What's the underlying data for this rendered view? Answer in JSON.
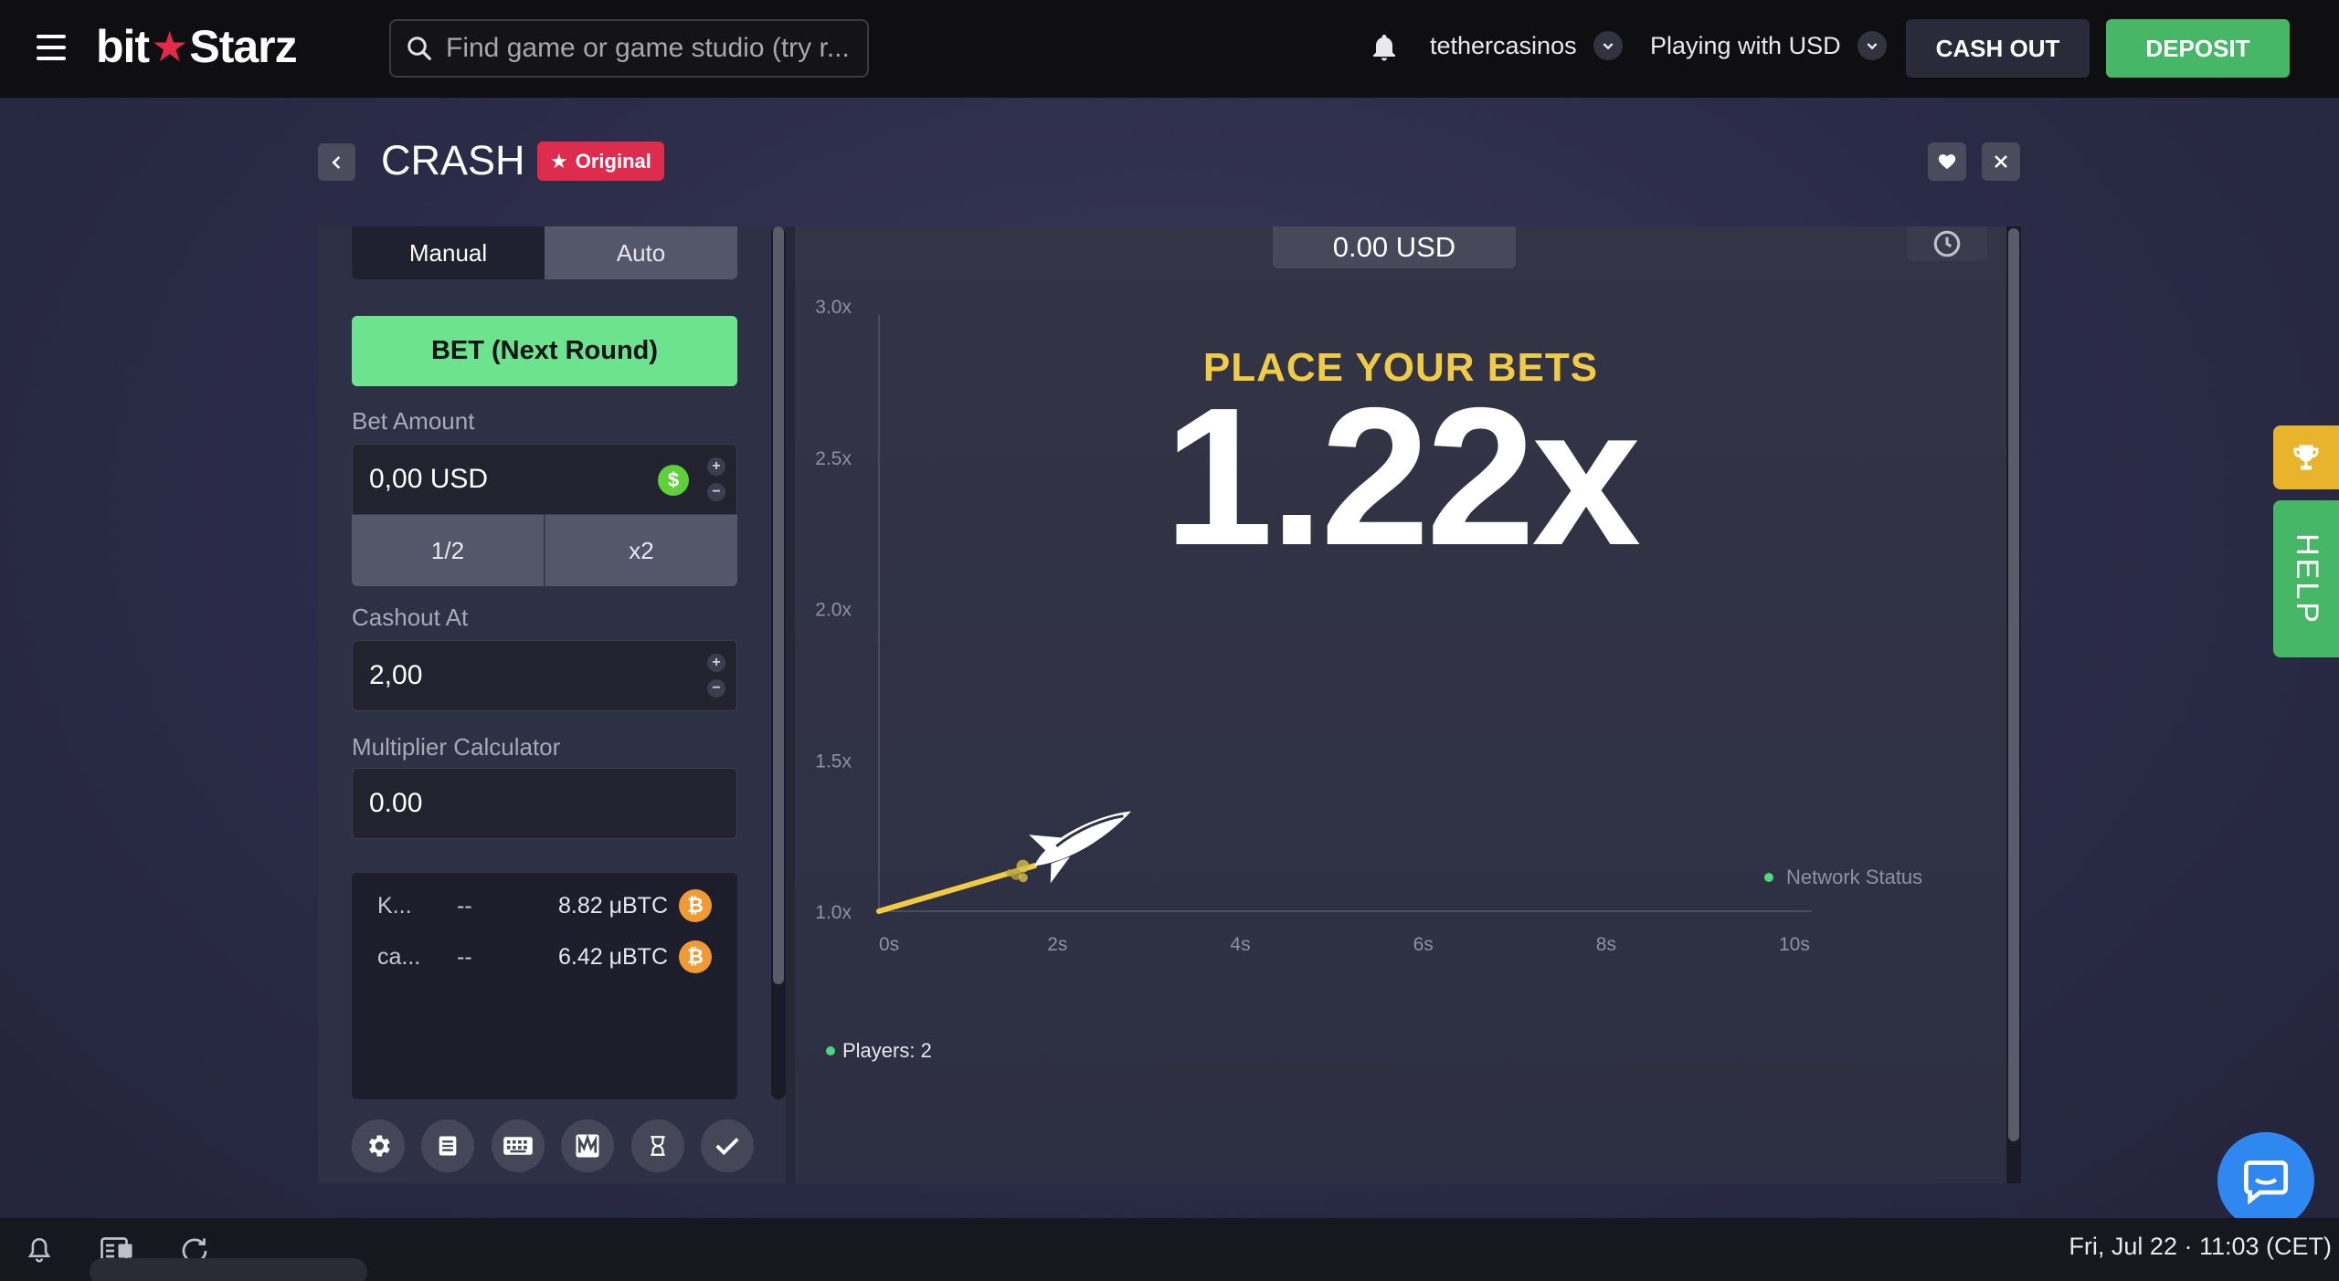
{
  "topbar": {
    "logo_left": "bit",
    "logo_right": "Starz",
    "search_placeholder": "Find game or game studio (try r...",
    "username": "tethercasinos",
    "currency_label": "Playing with USD",
    "cashout_label": "CASH OUT",
    "deposit_label": "DEPOSIT"
  },
  "game_header": {
    "title": "CRASH",
    "badge": "Original"
  },
  "left_panel": {
    "tabs": [
      "Manual",
      "Auto"
    ],
    "bet_button": "BET (Next Round)",
    "bet_amount_label": "Bet Amount",
    "bet_amount_value": "0,00 USD",
    "half_label": "1/2",
    "double_label": "x2",
    "cashout_label": "Cashout At",
    "cashout_value": "2,00",
    "calc_label": "Multiplier Calculator",
    "calc_value": "0.00",
    "players": [
      {
        "name": "K...",
        "mult": "--",
        "amount": "8.82 μBTC"
      },
      {
        "name": "ca...",
        "mult": "--",
        "amount": "6.42 μBTC"
      }
    ]
  },
  "game_area": {
    "balance": "0.00 USD",
    "status": "PLACE YOUR BETS",
    "multiplier": "1.22x",
    "network_status": "Network Status",
    "players_count": "Players: 2"
  },
  "chart_data": {
    "type": "line",
    "x_ticks": [
      "0s",
      "2s",
      "4s",
      "6s",
      "8s",
      "10s"
    ],
    "y_ticks": [
      "1.0x",
      "1.5x",
      "2.0x",
      "2.5x",
      "3.0x"
    ],
    "xlim": [
      0,
      10
    ],
    "ylim": [
      1.0,
      3.0
    ],
    "series": [
      {
        "x": [
          0,
          1.7
        ],
        "y": [
          1.0,
          1.15
        ]
      }
    ],
    "line_color": "#f2cb45"
  },
  "side": {
    "help_label": "HELP"
  },
  "bottombar": {
    "datetime": "Fri, Jul 22 · 11:03 (CET)"
  }
}
